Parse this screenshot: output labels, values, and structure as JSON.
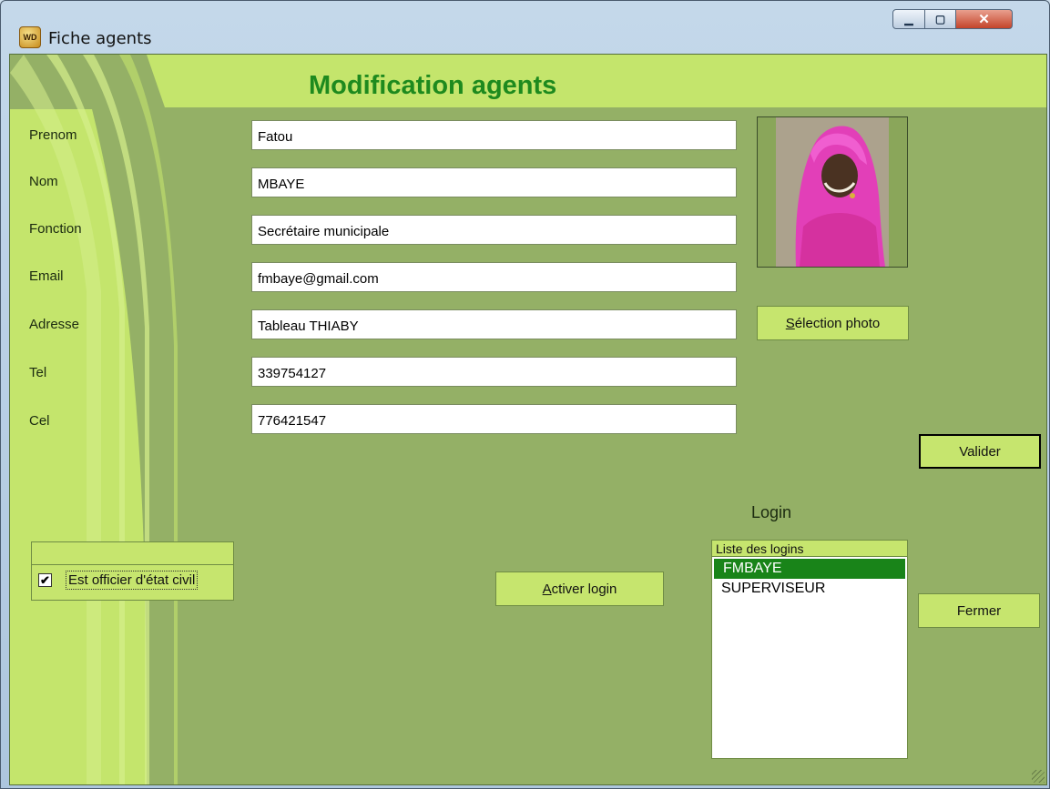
{
  "window": {
    "title": "Fiche agents",
    "app_icon": "wd-icon",
    "controls": {
      "minimize": "minimize-icon",
      "maximize": "maximize-icon",
      "close": "close-icon"
    }
  },
  "header": {
    "title": "Modification agents"
  },
  "form": {
    "fields": [
      {
        "key": "prenom",
        "label": "Prenom",
        "value": "Fatou"
      },
      {
        "key": "nom",
        "label": "Nom",
        "value": "MBAYE"
      },
      {
        "key": "fonction",
        "label": "Fonction",
        "value": "Secrétaire municipale"
      },
      {
        "key": "email",
        "label": "Email",
        "value": "fmbaye@gmail.com"
      },
      {
        "key": "adresse",
        "label": "Adresse",
        "value": "Tableau THIABY"
      },
      {
        "key": "tel",
        "label": "Tel",
        "value": "339754127"
      },
      {
        "key": "cel",
        "label": "Cel",
        "value": "776421547"
      }
    ]
  },
  "photo": {
    "button_label": "Sélection photo",
    "button_mnemonic": "S",
    "button_rest": "élection photo"
  },
  "officer_checkbox": {
    "label": "Est officier d'état civil",
    "checked": true
  },
  "buttons": {
    "activer_login": {
      "mnemonic": "A",
      "rest": "ctiver login"
    },
    "valider": "Valider",
    "fermer": "Fermer"
  },
  "login": {
    "title": "Login",
    "list_header": "Liste des logins",
    "items": [
      {
        "label": "FMBAYE",
        "selected": true
      },
      {
        "label": "SUPERVISEUR",
        "selected": false
      }
    ]
  },
  "colors": {
    "header_band": "#c4e56c",
    "header_title": "#1e8a1e",
    "client_bg": "#94b066",
    "selection": "#198419"
  }
}
